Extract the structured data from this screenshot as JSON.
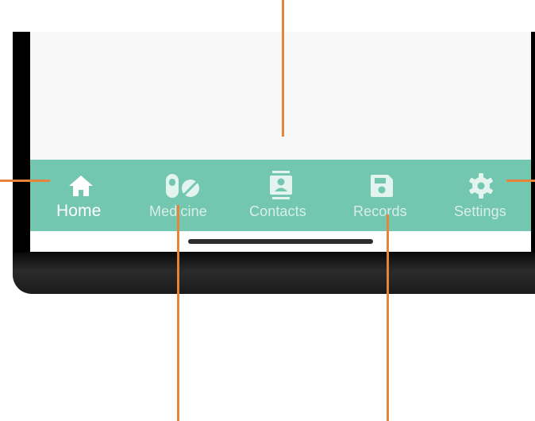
{
  "colors": {
    "nav_background": "#73c6af",
    "content_background": "#f8f8f8",
    "callout_line": "#e8833a",
    "active_label": "#ffffff",
    "inactive_label": "rgba(255,255,255,0.72)"
  },
  "bottom_nav": {
    "active": "Home",
    "items": [
      {
        "label": "Home",
        "icon": "home-icon"
      },
      {
        "label": "Medicine",
        "icon": "pills-icon"
      },
      {
        "label": "Contacts",
        "icon": "contacts-icon"
      },
      {
        "label": "Records",
        "icon": "save-icon"
      },
      {
        "label": "Settings",
        "icon": "gear-icon"
      }
    ]
  }
}
